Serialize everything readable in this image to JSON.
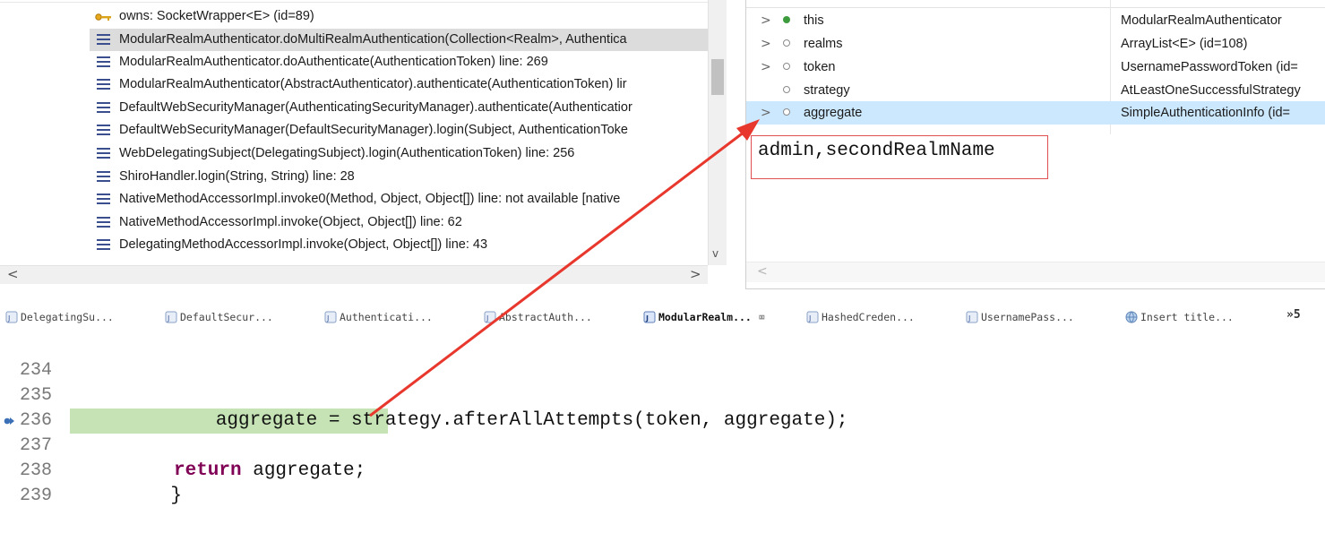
{
  "debug": {
    "call_stack": [
      {
        "icon": "owns-icon",
        "text": "owns: SocketWrapper<E>  (id=89)",
        "selected": false
      },
      {
        "icon": "stack-frame-icon",
        "text": "ModularRealmAuthenticator.doMultiRealmAuthentication(Collection<Realm>, Authentica",
        "selected": true
      },
      {
        "icon": "stack-frame-icon",
        "text": "ModularRealmAuthenticator.doAuthenticate(AuthenticationToken) line: 269",
        "selected": false
      },
      {
        "icon": "stack-frame-icon",
        "text": "ModularRealmAuthenticator(AbstractAuthenticator).authenticate(AuthenticationToken) lir",
        "selected": false
      },
      {
        "icon": "stack-frame-icon",
        "text": "DefaultWebSecurityManager(AuthenticatingSecurityManager).authenticate(Authenticatior",
        "selected": false
      },
      {
        "icon": "stack-frame-icon",
        "text": "DefaultWebSecurityManager(DefaultSecurityManager).login(Subject, AuthenticationToke",
        "selected": false
      },
      {
        "icon": "stack-frame-icon",
        "text": "WebDelegatingSubject(DelegatingSubject).login(AuthenticationToken) line: 256",
        "selected": false
      },
      {
        "icon": "stack-frame-icon",
        "text": "ShiroHandler.login(String, String) line: 28",
        "selected": false
      },
      {
        "icon": "stack-frame-icon",
        "text": "NativeMethodAccessorImpl.invoke0(Method, Object, Object[]) line: not available [native",
        "selected": false
      },
      {
        "icon": "stack-frame-icon",
        "text": "NativeMethodAccessorImpl.invoke(Object, Object[]) line: 62",
        "selected": false
      },
      {
        "icon": "stack-frame-icon",
        "text": "DelegatingMethodAccessorImpl.invoke(Object, Object[]) line: 43",
        "selected": false
      }
    ],
    "scroll_left": "<",
    "scroll_right": ">",
    "scroll_down": "v"
  },
  "variables": {
    "rows": [
      {
        "chevron": ">",
        "dot": "public",
        "name": "this",
        "value": "ModularRealmAuthenticator",
        "selected": false
      },
      {
        "chevron": ">",
        "dot": "field",
        "name": "realms",
        "value": "ArrayList<E>  (id=108)",
        "selected": false
      },
      {
        "chevron": ">",
        "dot": "field",
        "name": "token",
        "value": "UsernamePasswordToken  (id=",
        "selected": false
      },
      {
        "chevron": "",
        "dot": "field",
        "name": "strategy",
        "value": "AtLeastOneSuccessfulStrategy",
        "selected": false
      },
      {
        "chevron": ">",
        "dot": "field",
        "name": "aggregate",
        "value": "SimpleAuthenticationInfo  (id=",
        "selected": true
      }
    ],
    "detail_value": "admin,secondRealmName",
    "scroll_left": "<"
  },
  "editor": {
    "tabs": [
      {
        "label": "DelegatingSu...",
        "active": false
      },
      {
        "label": "DefaultSecur...",
        "active": false
      },
      {
        "label": "Authenticati...",
        "active": false
      },
      {
        "label": "AbstractAuth...",
        "active": false
      },
      {
        "label": "ModularRealm...",
        "active": true,
        "close": "⌧"
      },
      {
        "label": "HashedCreden...",
        "active": false
      },
      {
        "label": "UsernamePass...",
        "active": false
      },
      {
        "label": "Insert title...",
        "active": false
      }
    ],
    "tab_overflow": "»5",
    "lines": [
      {
        "number": "234",
        "code": ""
      },
      {
        "number": "235",
        "code": "        aggregate = strategy.afterAllAttempts(token, aggregate);"
      },
      {
        "number": "236",
        "code": ""
      },
      {
        "number": "237",
        "keyword": "return",
        "code": " aggregate;"
      },
      {
        "number": "238",
        "code": "    }"
      },
      {
        "number": "239",
        "code": ""
      }
    ]
  },
  "colors": {
    "selection_gray": "#dcdcdc",
    "selection_blue": "#cce8ff",
    "current_line": "#c5e3b4",
    "keyword": "#7f0055",
    "annotation": "#e8382e"
  }
}
